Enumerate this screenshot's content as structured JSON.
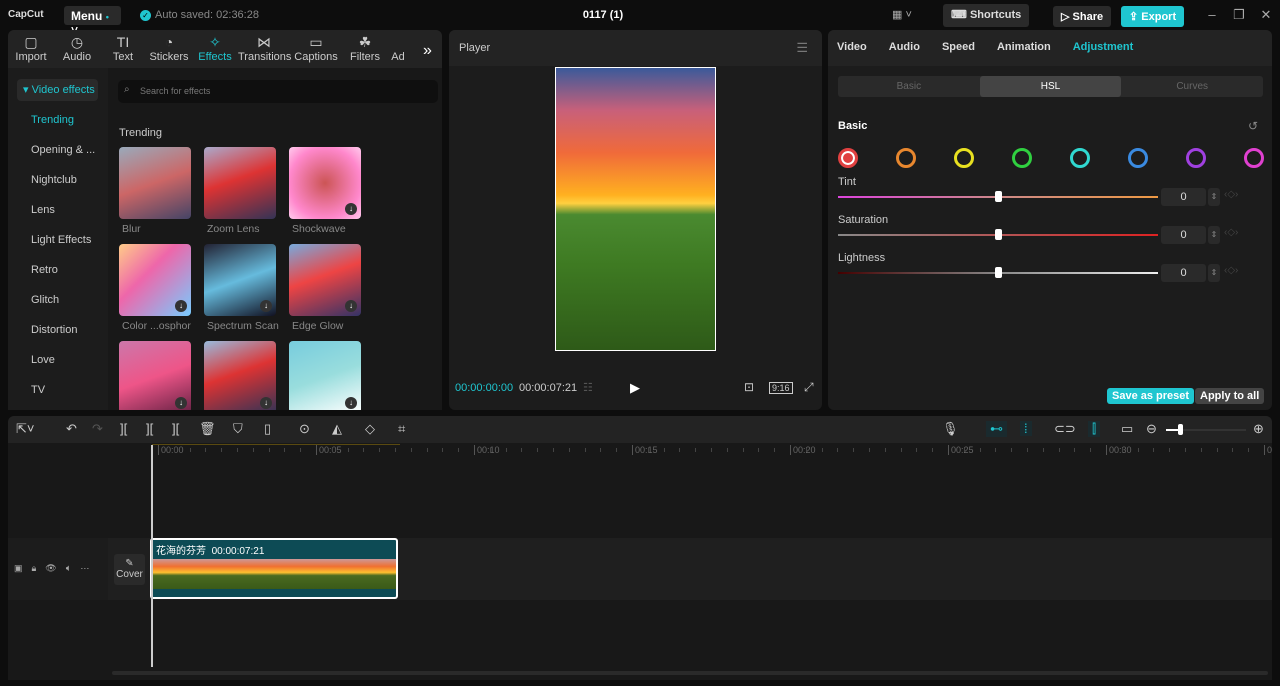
{
  "app": {
    "logo": "CapCut",
    "menu": "Menu",
    "autosave": "Auto saved: 02:36:28",
    "project_title": "0117 (1)",
    "shortcuts": "Shortcuts",
    "share": "Share",
    "export": "Export"
  },
  "toolbar": [
    {
      "label": "Import",
      "icon": "▢"
    },
    {
      "label": "Audio",
      "icon": "◷"
    },
    {
      "label": "Text",
      "icon": "TI"
    },
    {
      "label": "Stickers",
      "icon": "◔"
    },
    {
      "label": "Effects",
      "icon": "✧"
    },
    {
      "label": "Transitions",
      "icon": "⋈"
    },
    {
      "label": "Captions",
      "icon": "▭"
    },
    {
      "label": "Filters",
      "icon": "☘"
    },
    {
      "label": "Ad",
      "icon": ""
    }
  ],
  "sidebar": {
    "header": "Video effects",
    "items": [
      "Trending",
      "Opening & ...",
      "Nightclub",
      "Lens",
      "Light Effects",
      "Retro",
      "Glitch",
      "Distortion",
      "Love",
      "TV"
    ]
  },
  "effects": {
    "search_placeholder": "Search for effects",
    "section": "Trending",
    "items": [
      "Blur",
      "Zoom Lens",
      "Shockwave",
      "Color ...osphor",
      "Spectrum Scan",
      "Edge Glow",
      "",
      "",
      ""
    ]
  },
  "player": {
    "title": "Player",
    "current": "00:00:00:00",
    "duration": "00:00:07:21",
    "ratio": "9:16"
  },
  "inspector": {
    "tabs": [
      "Video",
      "Audio",
      "Speed",
      "Animation",
      "Adjustment"
    ],
    "active_tab": "Adjustment",
    "segments": [
      "Basic",
      "HSL",
      "Curves"
    ],
    "active_segment": "HSL",
    "section": "Basic",
    "colors": [
      "#e04040",
      "#e8872e",
      "#e8e020",
      "#30d040",
      "#30d8d0",
      "#3a8ae0",
      "#a040e0",
      "#e040d0"
    ],
    "sliders": [
      {
        "label": "Tint",
        "value": "0",
        "fraction": 0.5
      },
      {
        "label": "Saturation",
        "value": "0",
        "fraction": 0.5
      },
      {
        "label": "Lightness",
        "value": "0",
        "fraction": 0.5
      }
    ],
    "save_preset": "Save as preset",
    "apply_all": "Apply to all"
  },
  "timeline": {
    "ticks": [
      "00:00",
      "00:05",
      "00:10",
      "00:15",
      "00:20",
      "00:25",
      "00:30",
      "0"
    ],
    "cover": "Cover",
    "clip_name": "花海的芬芳",
    "clip_duration": "00:00:07:21"
  },
  "accent": "#1fc6d0"
}
